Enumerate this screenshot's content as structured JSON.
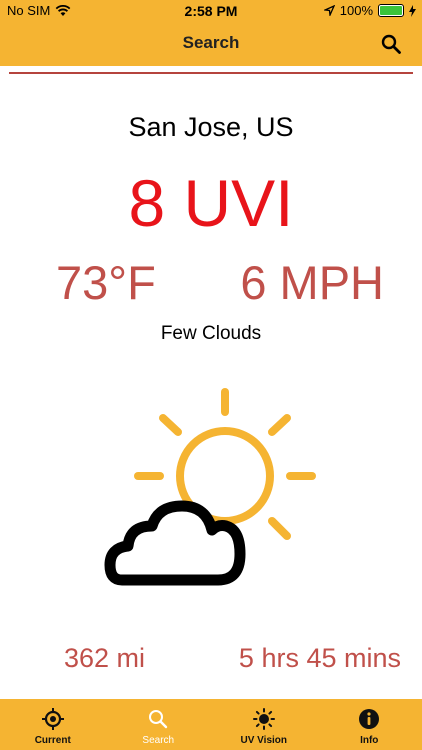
{
  "status_bar": {
    "carrier": "No SIM",
    "time": "2:58 PM",
    "battery": "100%"
  },
  "header": {
    "title": "Search",
    "search_icon": "search-icon"
  },
  "weather": {
    "location": "San Jose, US",
    "uvi": "8 UVI",
    "temperature": "73°F",
    "wind": "6 MPH",
    "description": "Few Clouds",
    "icon": "partly-cloudy-icon",
    "distance": "362 mi",
    "duration": "5 hrs 45 mins"
  },
  "colors": {
    "accent": "#f5b432",
    "uvi": "#e8141a",
    "secondary": "#c0504a",
    "sun": "#f5b432"
  },
  "tabs": [
    {
      "label": "Current",
      "icon": "crosshair-icon"
    },
    {
      "label": "Search",
      "icon": "search-icon"
    },
    {
      "label": "UV Vision",
      "icon": "sun-icon"
    },
    {
      "label": "Info",
      "icon": "info-icon"
    }
  ]
}
